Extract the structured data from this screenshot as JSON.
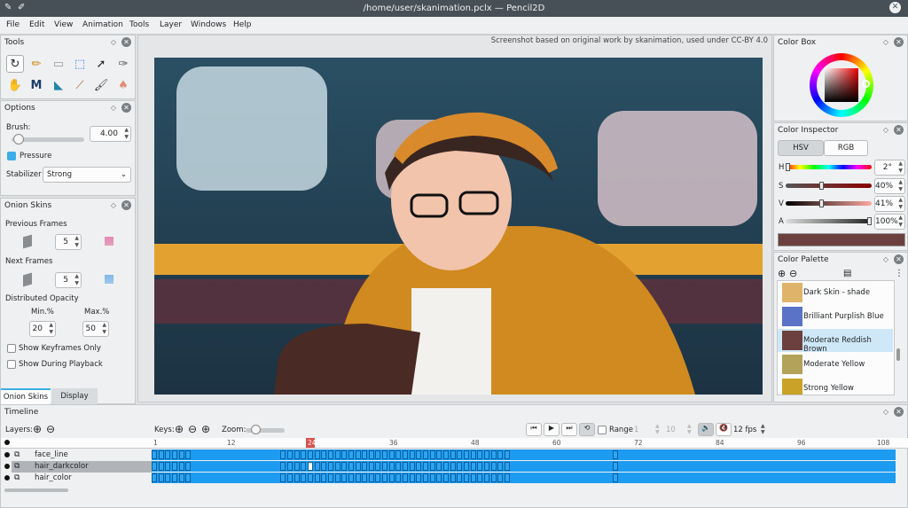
{
  "window": {
    "title": "/home/user/skanimation.pclx — Pencil2D"
  },
  "menu": [
    "File",
    "Edit",
    "View",
    "Animation",
    "Tools",
    "Layer",
    "Windows",
    "Help"
  ],
  "tools_panel": {
    "title": "Tools"
  },
  "options_panel": {
    "title": "Options",
    "brush_label": "Brush:",
    "brush_value": "4.00",
    "pressure_label": "Pressure",
    "pressure_checked": true,
    "stabilizer_label": "Stabilizer",
    "stabilizer_value": "Strong"
  },
  "onion_panel": {
    "title": "Onion Skins",
    "previous_label": "Previous Frames",
    "previous_value": "5",
    "next_label": "Next Frames",
    "next_value": "5",
    "distributed_label": "Distributed Opacity",
    "min_label": "Min.%",
    "max_label": "Max.%",
    "min_value": "20",
    "max_value": "50",
    "keyframes_only_label": "Show Keyframes Only",
    "during_playback_label": "Show During Playback",
    "tab_onion": "Onion Skins",
    "tab_display": "Display"
  },
  "canvas": {
    "credit": "Screenshot based on original work by skanimation, used under CC-BY 4.0"
  },
  "color_box": {
    "title": "Color Box"
  },
  "color_inspector": {
    "title": "Color Inspector",
    "tab_hsv": "HSV",
    "tab_rgb": "RGB",
    "h_label": "H",
    "h_value": "2°",
    "s_label": "S",
    "s_value": "40%",
    "v_label": "V",
    "v_value": "41%",
    "a_label": "A",
    "a_value": "100%",
    "current_color": "#6b403e"
  },
  "color_palette": {
    "title": "Color Palette",
    "items": [
      {
        "name": "Dark Skin - shade",
        "color": "#e0b36a"
      },
      {
        "name": "Brilliant Purplish Blue",
        "color": "#5a73c7"
      },
      {
        "name": "Moderate Reddish Brown",
        "color": "#6b403e"
      },
      {
        "name": "Moderate Yellow",
        "color": "#b3a35a"
      },
      {
        "name": "Strong Yellow",
        "color": "#c9a227"
      }
    ]
  },
  "timeline": {
    "title": "Timeline",
    "layers_label": "Layers:",
    "keys_label": "Keys:",
    "zoom_label": "Zoom:",
    "range_label": "Range",
    "range_start": "1",
    "range_end": "10",
    "fps_value": "12 fps",
    "ruler": [
      "1",
      "12",
      "24",
      "36",
      "48",
      "60",
      "72",
      "84",
      "96",
      "108"
    ],
    "current_frame": "24",
    "layers": [
      {
        "name": "face_line"
      },
      {
        "name": "hair_darkcolor"
      },
      {
        "name": "hair_color"
      }
    ]
  },
  "colors": {
    "accent": "#3daee9",
    "track": "#1d9bf0",
    "playhead": "#d9534f"
  }
}
